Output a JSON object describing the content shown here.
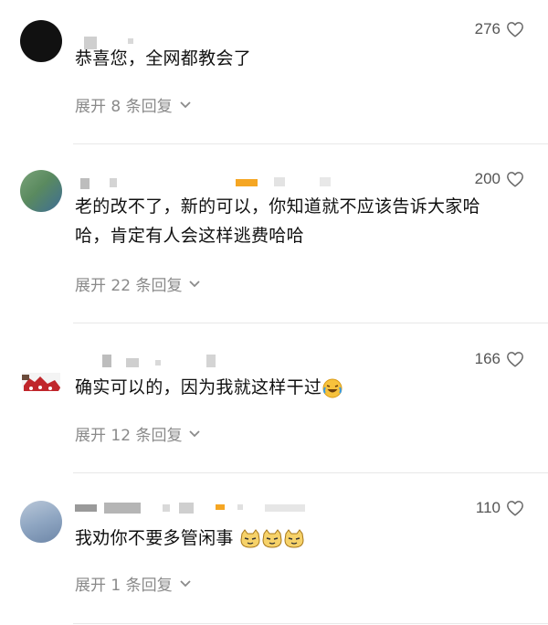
{
  "comments": [
    {
      "text": "恭喜您，全网都教会了",
      "likes": "276",
      "expand_label": "展开 8 条回复"
    },
    {
      "text": "老的改不了，新的可以，你知道就不应该告诉大家哈哈，肯定有人会这样逃费哈哈",
      "likes": "200",
      "expand_label": "展开 22 条回复"
    },
    {
      "text": "确实可以的，因为我就这样干过",
      "likes": "166",
      "expand_label": "展开 12 条回复",
      "trailing_emoji": "laughing-tears-emoji"
    },
    {
      "text": "我劝你不要多管闲事",
      "likes": "110",
      "expand_label": "展开 1 条回复",
      "trailing_emoji": "cat-smirk-emoji x3"
    }
  ],
  "icons": {
    "like": "heart-outline-icon",
    "expand": "chevron-down-icon"
  },
  "colors": {
    "text": "#111111",
    "secondary": "#8a8a8a",
    "likes": "#555555",
    "highlight": "#f5a623"
  }
}
